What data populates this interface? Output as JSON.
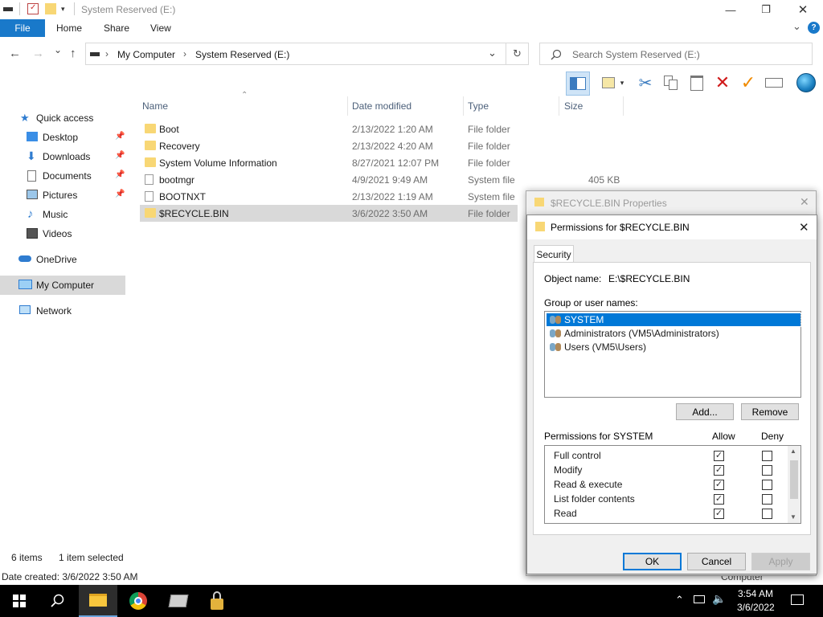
{
  "window": {
    "title": "System Reserved (E:)",
    "minimize": "—",
    "maximize": "❐",
    "close": "✕"
  },
  "ribbon": {
    "tabs": [
      "File",
      "Home",
      "Share",
      "View"
    ],
    "collapse": "⌄",
    "help": "?"
  },
  "address": {
    "back": "←",
    "forward": "→",
    "recent": "⌄",
    "up": "↑",
    "crumbs": [
      "My Computer",
      "System Reserved (E:)"
    ],
    "separator": "›",
    "dropdown": "⌄",
    "refresh": "↻",
    "search_placeholder": "Search System Reserved (E:)"
  },
  "toolbar": {
    "icons": [
      "preview-pane-icon",
      "properties-icon",
      "cut-icon",
      "copy-icon",
      "paste-icon",
      "delete-icon",
      "checkmark-icon",
      "rename-icon",
      "globe-icon"
    ],
    "delete_color": "#d01a1a",
    "check_color": "#f08a00"
  },
  "nav": {
    "quick_access": "Quick access",
    "items": [
      {
        "label": "Desktop",
        "pinned": true
      },
      {
        "label": "Downloads",
        "pinned": true
      },
      {
        "label": "Documents",
        "pinned": true
      },
      {
        "label": "Pictures",
        "pinned": true
      },
      {
        "label": "Music",
        "pinned": false
      },
      {
        "label": "Videos",
        "pinned": false
      }
    ],
    "onedrive": "OneDrive",
    "my_computer": "My Computer",
    "network": "Network"
  },
  "files": {
    "columns": [
      "Name",
      "Date modified",
      "Type",
      "Size"
    ],
    "rows": [
      {
        "name": "Boot",
        "date": "2/13/2022 1:20 AM",
        "type": "File folder",
        "size": "",
        "kind": "folder"
      },
      {
        "name": "Recovery",
        "date": "2/13/2022 4:20 AM",
        "type": "File folder",
        "size": "",
        "kind": "folder"
      },
      {
        "name": "System Volume Information",
        "date": "8/27/2021 12:07 PM",
        "type": "File folder",
        "size": "",
        "kind": "folder"
      },
      {
        "name": "bootmgr",
        "date": "4/9/2021 9:49 AM",
        "type": "System file",
        "size": "405 KB",
        "kind": "file"
      },
      {
        "name": "BOOTNXT",
        "date": "2/13/2022 1:19 AM",
        "type": "System file",
        "size": "",
        "kind": "file"
      },
      {
        "name": "$RECYCLE.BIN",
        "date": "3/6/2022 3:50 AM",
        "type": "File folder",
        "size": "",
        "kind": "folder",
        "selected": true
      }
    ]
  },
  "status": {
    "items": "6 items",
    "selected": "1 item selected",
    "date_created": "Date created: 3/6/2022 3:50 AM",
    "peek": "Computer"
  },
  "properties_dialog": {
    "title": "$RECYCLE.BIN Properties",
    "close": "✕"
  },
  "permissions_dialog": {
    "title": "Permissions for $RECYCLE.BIN",
    "close": "✕",
    "tab": "Security",
    "object_name_label": "Object name:",
    "object_name_value": "E:\\$RECYCLE.BIN",
    "group_label": "Group or user names:",
    "users": [
      {
        "name": "SYSTEM",
        "selected": true
      },
      {
        "name": "Administrators (VM5\\Administrators)",
        "selected": false
      },
      {
        "name": "Users (VM5\\Users)",
        "selected": false
      }
    ],
    "add_button": "Add...",
    "remove_button": "Remove",
    "perms_label": "Permissions for SYSTEM",
    "allow_header": "Allow",
    "deny_header": "Deny",
    "permissions": [
      {
        "name": "Full control",
        "allow": true,
        "deny": false
      },
      {
        "name": "Modify",
        "allow": true,
        "deny": false
      },
      {
        "name": "Read & execute",
        "allow": true,
        "deny": false
      },
      {
        "name": "List folder contents",
        "allow": true,
        "deny": false
      },
      {
        "name": "Read",
        "allow": true,
        "deny": false
      }
    ],
    "ok_button": "OK",
    "cancel_button": "Cancel",
    "apply_button": "Apply"
  },
  "taskbar": {
    "time": "3:54 AM",
    "date": "3/6/2022"
  }
}
